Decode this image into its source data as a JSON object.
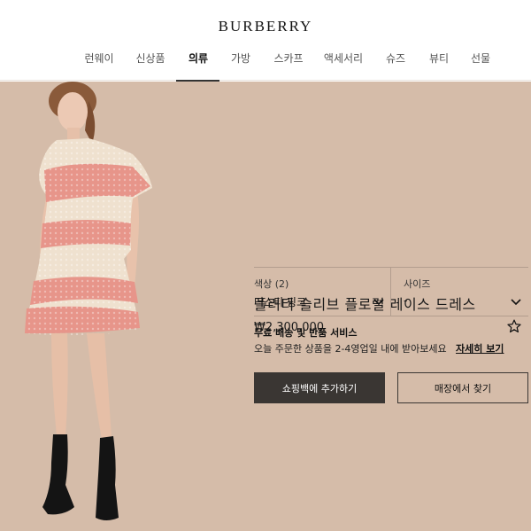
{
  "header": {
    "brand": "BURBERRY",
    "nav": [
      {
        "label": "런웨이"
      },
      {
        "label": "신상품"
      },
      {
        "label": "의류",
        "active": true
      },
      {
        "label": "가방"
      },
      {
        "label": "스카프"
      },
      {
        "label": "액세서리"
      },
      {
        "label": "슈즈"
      },
      {
        "label": "뷰티"
      },
      {
        "label": "선물"
      }
    ]
  },
  "product": {
    "title": "플러터 슬리브 플로럴 레이스 드레스",
    "price": "₩2,300,000",
    "wishlist_icon": "star-outline-icon",
    "color": {
      "label": "색상 (2)",
      "value": "더스티 핑크"
    },
    "size": {
      "label": "사이즈",
      "value": "-"
    },
    "shipping": {
      "title": "무료 배송 및 반품 서비스",
      "description": "오늘 주문한 상품을 2-4영업일 내에 받아보세요",
      "link": "자세히 보기"
    },
    "add_to_bag": "쇼핑백에 추가하기",
    "find_in_store": "매장에서 찾기"
  },
  "colors": {
    "hero_bg": "#d5bca9",
    "button_dark": "#3a3633",
    "dress_pink": "#e7958a",
    "dress_cream": "#efe1cf"
  }
}
